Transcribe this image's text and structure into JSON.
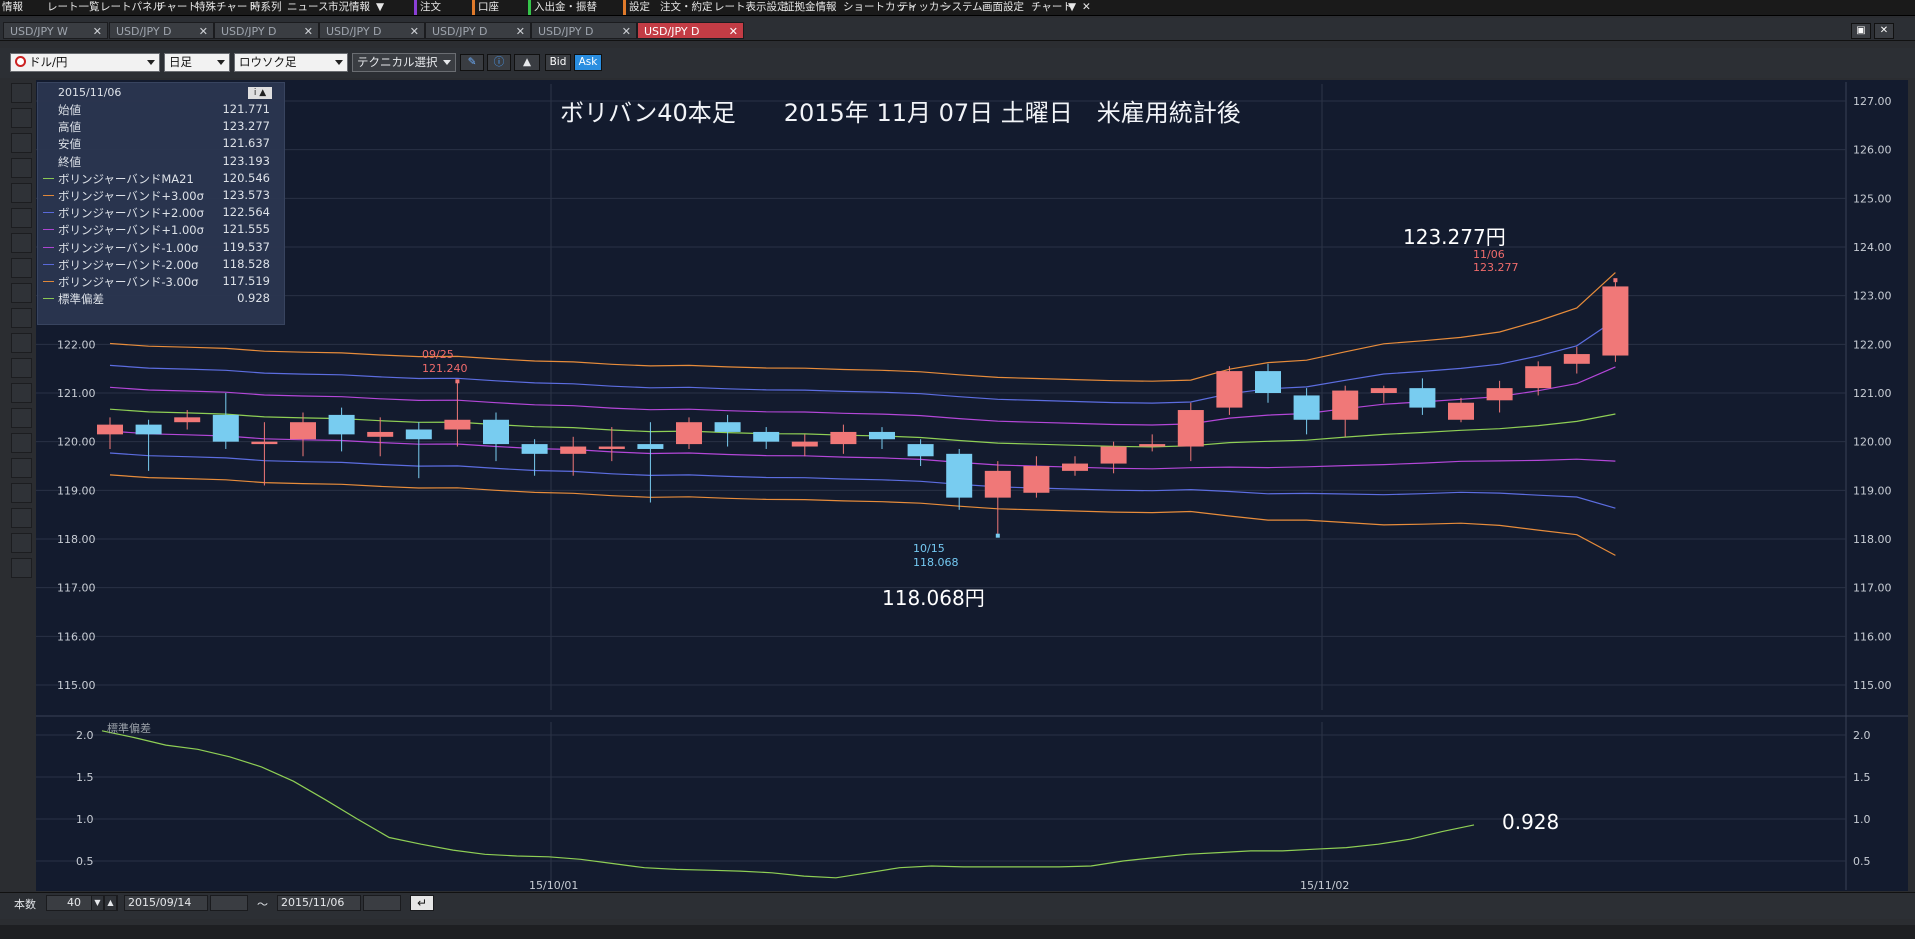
{
  "top_menu": {
    "items": [
      "情報",
      "レート一覧",
      "レートパネル",
      "チャート",
      "特殊チャート",
      "時系列",
      "ニュース",
      "市況情報",
      "▼",
      "注文",
      "口座",
      "入出金・振替",
      "設定",
      "注文・約定",
      "レート表示設定",
      "証拠金情報",
      "ショートカット",
      "ティッカー",
      "システム",
      "画面設定",
      "チャート",
      "▼",
      "✕"
    ]
  },
  "tabs": [
    {
      "label": "USD/JPY W",
      "active": false
    },
    {
      "label": "USD/JPY D",
      "active": false
    },
    {
      "label": "USD/JPY D",
      "active": false
    },
    {
      "label": "USD/JPY D",
      "active": false
    },
    {
      "label": "USD/JPY D",
      "active": false
    },
    {
      "label": "USD/JPY D",
      "active": false
    },
    {
      "label": "USD/JPY D",
      "active": true
    }
  ],
  "toolbar": {
    "pair": "ドル/円",
    "period": "日足",
    "chart_type": "ロウソク足",
    "technical": "テクニカル選択",
    "bid": "Bid",
    "ask": "Ask"
  },
  "info_panel": {
    "date": "2015/11/06",
    "rows": [
      {
        "label": "始値",
        "value": "121.771",
        "color": ""
      },
      {
        "label": "高値",
        "value": "123.277",
        "color": ""
      },
      {
        "label": "安値",
        "value": "121.637",
        "color": ""
      },
      {
        "label": "終値",
        "value": "123.193",
        "color": ""
      },
      {
        "label": "ボリンジャーバンドMA21",
        "value": "120.546",
        "color": "#8fcf55"
      },
      {
        "label": "ボリンジャーバンド+3.00σ",
        "value": "123.573",
        "color": "#e78c3b"
      },
      {
        "label": "ボリンジャーバンド+2.00σ",
        "value": "122.564",
        "color": "#5c6de0"
      },
      {
        "label": "ボリンジャーバンド+1.00σ",
        "value": "121.555",
        "color": "#b347d8"
      },
      {
        "label": "ボリンジャーバンド-1.00σ",
        "value": "119.537",
        "color": "#b347d8"
      },
      {
        "label": "ボリンジャーバンド-2.00σ",
        "value": "118.528",
        "color": "#5c6de0"
      },
      {
        "label": "ボリンジャーバンド-3.00σ",
        "value": "117.519",
        "color": "#e78c3b"
      },
      {
        "label": "標準偏差",
        "value": "0.928",
        "color": "#8fcf55"
      }
    ]
  },
  "annotations": {
    "title": "ボリバン40本足　　2015年 11月 07日 土曜日　米雇用統計後",
    "high_big": "123.277円",
    "high_date": "11/06",
    "high_val": "123.277",
    "low_big": "118.068円",
    "low_date": "10/15",
    "low_val": "118.068",
    "mark_date": "09/25",
    "mark_val": "121.240",
    "std_big": "0.928",
    "std_label": "標準偏差"
  },
  "chart_data": [
    {
      "type": "candlestick",
      "title": "ボリバン40本足　　2015年 11月 07日 土曜日　米雇用統計後",
      "ylim": [
        114.8,
        127.3
      ],
      "yticks": [
        "127.00",
        "126.00",
        "125.00",
        "124.00",
        "123.00",
        "122.00",
        "121.00",
        "120.00",
        "119.00",
        "118.00",
        "117.00",
        "116.00",
        "115.00"
      ],
      "xticks": [
        "15/10/01",
        "15/11/02"
      ],
      "candles": [
        [
          120.15,
          120.35,
          119.85,
          120.5
        ],
        [
          120.35,
          120.15,
          119.4,
          120.45
        ],
        [
          120.4,
          120.5,
          120.25,
          120.65
        ],
        [
          120.55,
          120.0,
          119.85,
          121.0
        ],
        [
          119.95,
          120.0,
          119.1,
          120.4
        ],
        [
          120.05,
          120.4,
          119.7,
          120.6
        ],
        [
          120.55,
          120.15,
          119.8,
          120.7
        ],
        [
          120.1,
          120.2,
          119.7,
          120.5
        ],
        [
          120.25,
          120.05,
          119.25,
          120.4
        ],
        [
          120.25,
          120.45,
          119.9,
          121.24
        ],
        [
          120.45,
          119.95,
          119.6,
          120.6
        ],
        [
          119.95,
          119.75,
          119.3,
          120.05
        ],
        [
          119.75,
          119.9,
          119.3,
          120.1
        ],
        [
          119.85,
          119.9,
          119.6,
          120.3
        ],
        [
          119.95,
          119.85,
          118.75,
          120.4
        ],
        [
          119.95,
          120.4,
          119.85,
          120.5
        ],
        [
          120.4,
          120.2,
          119.9,
          120.55
        ],
        [
          120.2,
          120.0,
          119.85,
          120.3
        ],
        [
          119.9,
          120.0,
          119.7,
          120.15
        ],
        [
          119.95,
          120.2,
          119.75,
          120.35
        ],
        [
          120.2,
          120.05,
          119.85,
          120.3
        ],
        [
          119.95,
          119.7,
          119.5,
          120.05
        ],
        [
          119.75,
          118.85,
          118.6,
          119.85
        ],
        [
          118.85,
          119.4,
          118.07,
          119.6
        ],
        [
          118.95,
          119.5,
          118.85,
          119.7
        ],
        [
          119.4,
          119.55,
          119.3,
          119.7
        ],
        [
          119.55,
          119.9,
          119.35,
          120.0
        ],
        [
          119.9,
          119.95,
          119.8,
          120.15
        ],
        [
          119.9,
          120.65,
          119.6,
          120.8
        ],
        [
          120.7,
          121.45,
          120.55,
          121.55
        ],
        [
          121.45,
          121.0,
          120.8,
          121.6
        ],
        [
          120.95,
          120.45,
          120.15,
          121.1
        ],
        [
          120.45,
          121.05,
          120.1,
          121.15
        ],
        [
          121.0,
          121.1,
          120.8,
          121.15
        ],
        [
          121.1,
          120.7,
          120.55,
          121.3
        ],
        [
          120.45,
          120.8,
          120.4,
          120.9
        ],
        [
          120.85,
          121.1,
          120.6,
          121.25
        ],
        [
          121.1,
          121.55,
          120.95,
          121.65
        ],
        [
          121.6,
          121.8,
          121.4,
          121.95
        ],
        [
          121.77,
          123.19,
          121.64,
          123.28
        ]
      ],
      "bands": {
        "plus3": [
          null,
          null,
          null,
          null,
          null,
          null,
          null,
          null,
          null,
          null,
          null,
          null,
          null,
          null,
          null,
          null,
          null,
          null,
          null,
          null,
          null,
          null,
          null,
          null,
          null,
          null,
          null,
          null,
          null,
          null,
          null,
          null,
          null,
          null,
          null,
          null,
          null,
          null,
          null,
          null
        ],
        "labels": [
          "MA21",
          "+3σ",
          "+2σ",
          "+1σ",
          "-1σ",
          "-2σ",
          "-3σ"
        ]
      }
    },
    {
      "type": "line",
      "title": "標準偏差",
      "ylim": [
        0.2,
        2.1
      ],
      "yticks": [
        "2.0",
        "1.5",
        "1.0",
        "0.5"
      ],
      "values": [
        2.05,
        1.97,
        1.88,
        1.83,
        1.74,
        1.62,
        1.45,
        1.23,
        1.0,
        0.78,
        0.7,
        0.63,
        0.58,
        0.56,
        0.55,
        0.52,
        0.47,
        0.42,
        0.4,
        0.39,
        0.38,
        0.36,
        0.32,
        0.3,
        0.36,
        0.42,
        0.44,
        0.43,
        0.43,
        0.43,
        0.43,
        0.44,
        0.5,
        0.54,
        0.58,
        0.6,
        0.62,
        0.62,
        0.64,
        0.66,
        0.7,
        0.76,
        0.85,
        0.93
      ]
    }
  ],
  "bottom_bar": {
    "count_label": "本数",
    "count_value": "40",
    "start_date": "2015/09/14",
    "tilde": "～",
    "end_date": "2015/11/06"
  }
}
